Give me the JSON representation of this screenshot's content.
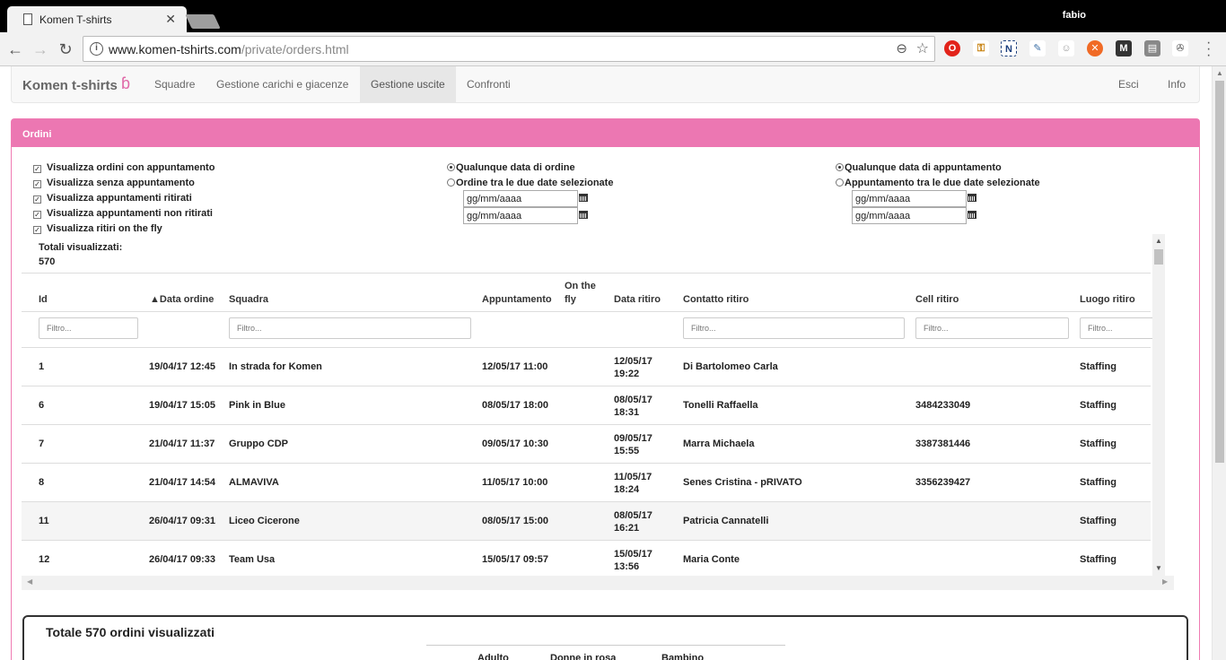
{
  "browser": {
    "tab_title": "Komen T-shirts",
    "profile_name": "fabio",
    "url_host": "www.komen-tshirts.com",
    "url_path": "/private/orders.html"
  },
  "navbar": {
    "brand": "Komen t-shirts",
    "links": [
      "Squadre",
      "Gestione carichi e giacenze",
      "Gestione uscite",
      "Confronti"
    ],
    "right_links": [
      "Esci",
      "Info"
    ]
  },
  "panel": {
    "title": "Ordini",
    "checkboxes": [
      "Visualizza ordini con appuntamento",
      "Visualizza senza appuntamento",
      "Visualizza appuntamenti ritirati",
      "Visualizza appuntamenti non ritirati",
      "Visualizza ritiri on the fly"
    ],
    "order_date": {
      "any": "Qualunque data di ordine",
      "between": "Ordine tra le due date selezionate",
      "from": "gg/mm/aaaa",
      "to": "gg/mm/aaaa"
    },
    "appointment_date": {
      "any": "Qualunque data di appuntamento",
      "between": "Appuntamento tra le due date selezionate",
      "from": "gg/mm/aaaa",
      "to": "gg/mm/aaaa"
    },
    "totals_label": "Totali visualizzati:",
    "totals_value": "570"
  },
  "table": {
    "headers": {
      "id": "Id",
      "data_ordine": "▲Data ordine",
      "squadra": "Squadra",
      "appuntamento": "Appuntamento",
      "on_the_fly_1": "On the",
      "on_the_fly_2": "fly",
      "data_ritiro": "Data ritiro",
      "contatto": "Contatto ritiro",
      "cell": "Cell ritiro",
      "luogo": "Luogo ritiro"
    },
    "filter_placeholder": "Filtro...",
    "rows": [
      {
        "id": "1",
        "data_ordine": "19/04/17 12:45",
        "squadra": "In strada for Komen",
        "appuntamento": "12/05/17 11:00",
        "ritiro_d": "12/05/17",
        "ritiro_t": "19:22",
        "contatto": "Di Bartolomeo Carla",
        "cell": "",
        "luogo": "Staffing"
      },
      {
        "id": "6",
        "data_ordine": "19/04/17 15:05",
        "squadra": "Pink in Blue",
        "appuntamento": "08/05/17 18:00",
        "ritiro_d": "08/05/17",
        "ritiro_t": "18:31",
        "contatto": "Tonelli Raffaella",
        "cell": "3484233049",
        "luogo": "Staffing"
      },
      {
        "id": "7",
        "data_ordine": "21/04/17 11:37",
        "squadra": "Gruppo CDP",
        "appuntamento": "09/05/17 10:30",
        "ritiro_d": "09/05/17",
        "ritiro_t": "15:55",
        "contatto": "Marra Michaela",
        "cell": "3387381446",
        "luogo": "Staffing"
      },
      {
        "id": "8",
        "data_ordine": "21/04/17 14:54",
        "squadra": "ALMAVIVA",
        "appuntamento": "11/05/17 10:00",
        "ritiro_d": "11/05/17",
        "ritiro_t": "18:24",
        "contatto": "Senes Cristina - pRIVATO",
        "cell": "3356239427",
        "luogo": "Staffing"
      },
      {
        "id": "11",
        "data_ordine": "26/04/17 09:31",
        "squadra": "Liceo Cicerone",
        "appuntamento": "08/05/17 15:00",
        "ritiro_d": "08/05/17",
        "ritiro_t": "16:21",
        "contatto": "Patricia Cannatelli",
        "cell": "",
        "luogo": "Staffing"
      },
      {
        "id": "12",
        "data_ordine": "26/04/17 09:33",
        "squadra": "Team Usa",
        "appuntamento": "15/05/17 09:57",
        "ritiro_d": "15/05/17",
        "ritiro_t": "13:56",
        "contatto": "Maria Conte",
        "cell": "",
        "luogo": "Staffing"
      }
    ]
  },
  "summary": {
    "title": "Totale 570 ordini visualizzati",
    "columns": [
      "Adulto",
      "Donne in rosa",
      "Bambino"
    ]
  },
  "colors": {
    "accent_pink": "#ec77b2"
  }
}
